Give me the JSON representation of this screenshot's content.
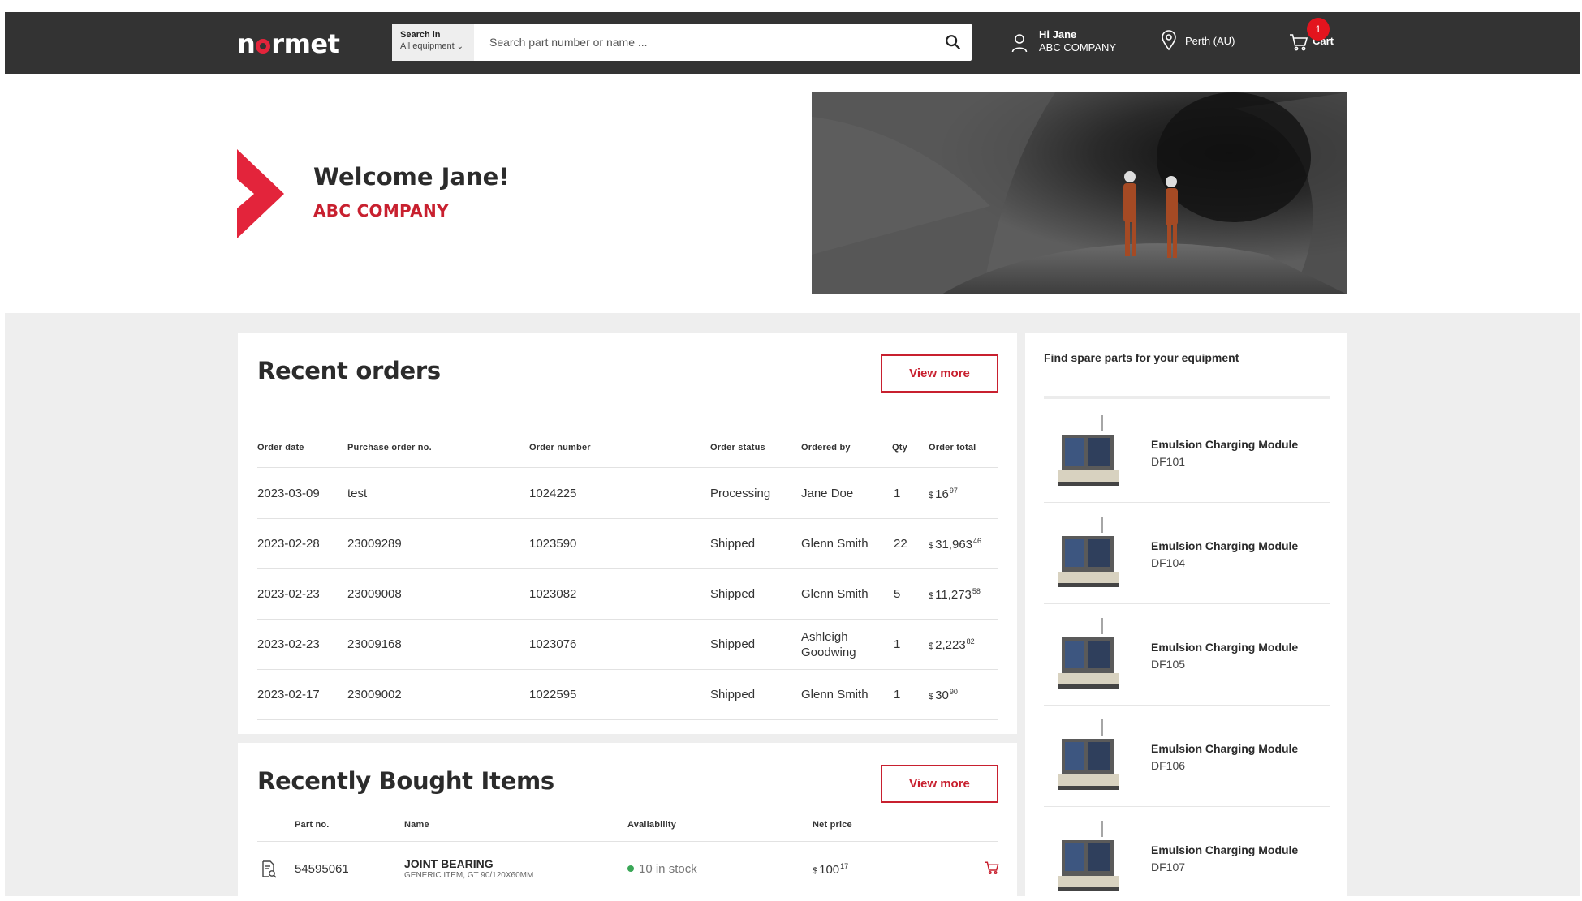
{
  "header": {
    "logo": "normet",
    "search_in_label": "Search in",
    "search_in_value": "All equipment",
    "search_placeholder": "Search part number or name ...",
    "user_greeting": "Hi Jane",
    "user_company": "ABC COMPANY",
    "location": "Perth (AU)",
    "cart_label": "Cart",
    "cart_count": "1"
  },
  "hero": {
    "welcome": "Welcome Jane!",
    "company": "ABC COMPANY"
  },
  "recent_orders": {
    "title": "Recent orders",
    "view_more": "View more",
    "columns": [
      "Order date",
      "Purchase order no.",
      "Order number",
      "Order status",
      "Ordered by",
      "Qty",
      "Order total"
    ],
    "rows": [
      {
        "date": "2023-03-09",
        "po": "test",
        "order": "1024225",
        "status": "Processing",
        "by": "Jane Doe",
        "qty": "1",
        "cur": "$",
        "total": "16",
        "cents": "97"
      },
      {
        "date": "2023-02-28",
        "po": "23009289",
        "order": "1023590",
        "status": "Shipped",
        "by": "Glenn Smith",
        "qty": "22",
        "cur": "$",
        "total": "31,963",
        "cents": "46"
      },
      {
        "date": "2023-02-23",
        "po": "23009008",
        "order": "1023082",
        "status": "Shipped",
        "by": "Glenn Smith",
        "qty": "5",
        "cur": "$",
        "total": "11,273",
        "cents": "58"
      },
      {
        "date": "2023-02-23",
        "po": "23009168",
        "order": "1023076",
        "status": "Shipped",
        "by": "Ashleigh Goodwing",
        "qty": "1",
        "cur": "$",
        "total": "2,223",
        "cents": "82"
      },
      {
        "date": "2023-02-17",
        "po": "23009002",
        "order": "1022595",
        "status": "Shipped",
        "by": "Glenn Smith",
        "qty": "1",
        "cur": "$",
        "total": "30",
        "cents": "90"
      }
    ]
  },
  "recently_bought": {
    "title": "Recently Bought Items",
    "view_more": "View more",
    "columns": [
      "Part no.",
      "Name",
      "Availability",
      "Net price"
    ],
    "rows": [
      {
        "part": "54595061",
        "name": "JOINT BEARING",
        "sub": "GENERIC ITEM, GT 90/120X60MM",
        "availability": "10 in stock",
        "cur": "$",
        "price": "100",
        "cents": "17"
      }
    ]
  },
  "spare_parts": {
    "title": "Find spare parts for your equipment",
    "items": [
      {
        "name": "Emulsion Charging Module",
        "code": "DF101"
      },
      {
        "name": "Emulsion Charging Module",
        "code": "DF104"
      },
      {
        "name": "Emulsion Charging Module",
        "code": "DF105"
      },
      {
        "name": "Emulsion Charging Module",
        "code": "DF106"
      },
      {
        "name": "Emulsion Charging Module",
        "code": "DF107"
      }
    ]
  },
  "colors": {
    "header_bg": "#333333",
    "accent": "#c8202f",
    "badge": "#e3141e",
    "panel_bg": "#eeeeee",
    "in_stock": "#3aa757"
  }
}
